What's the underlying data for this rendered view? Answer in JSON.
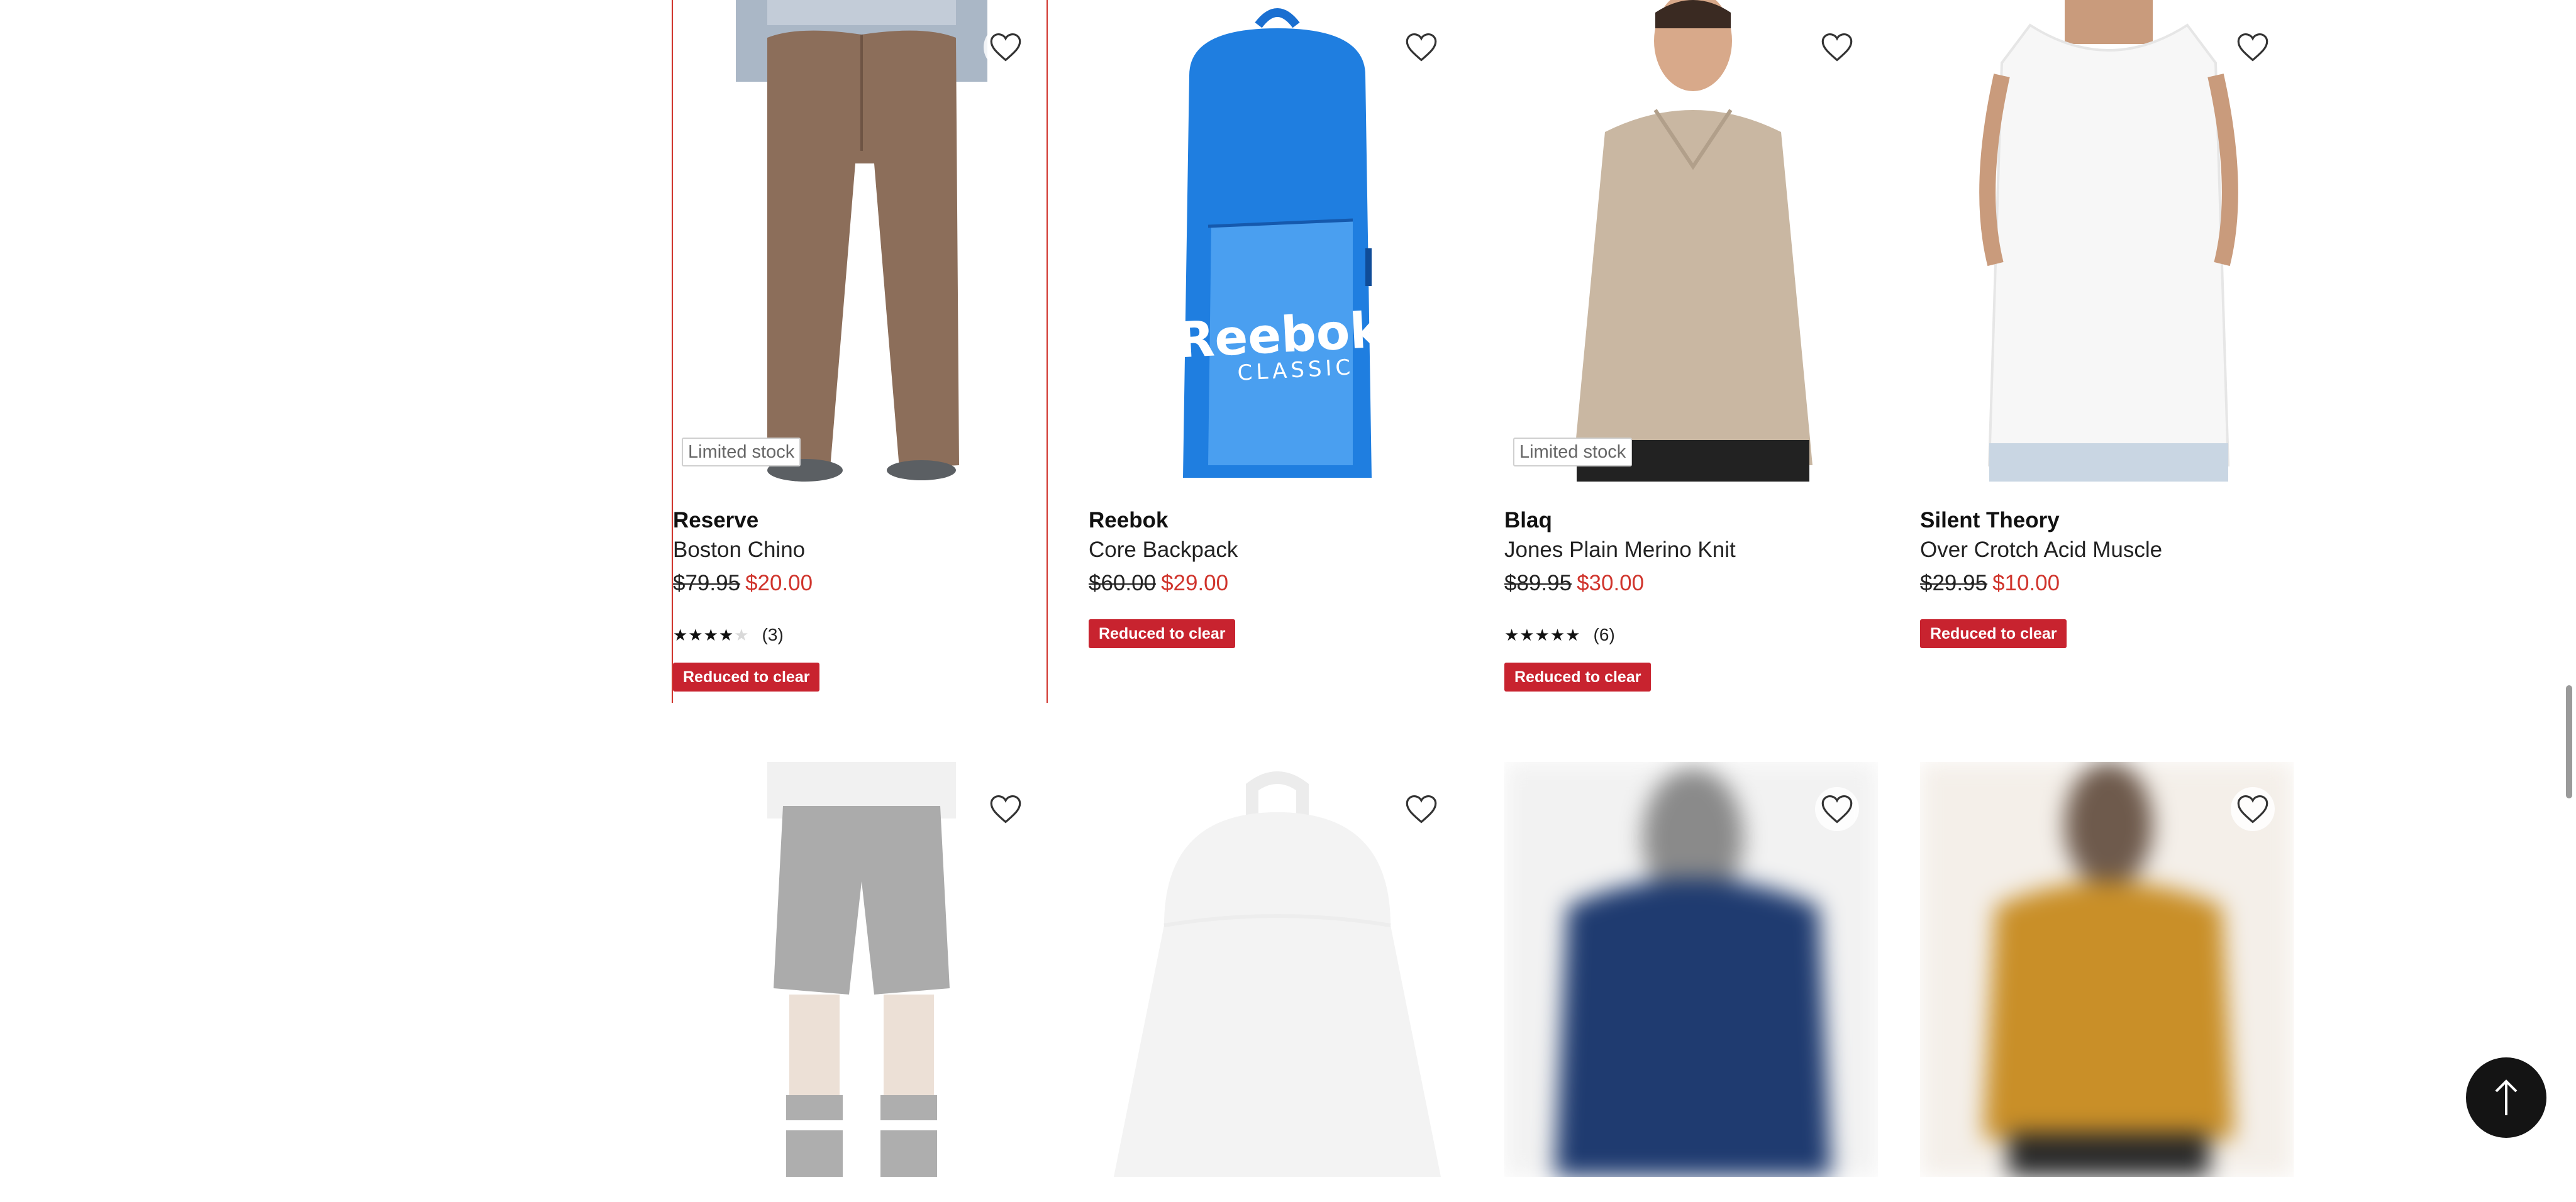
{
  "products": [
    {
      "brand": "Reserve",
      "name": "Boston Chino",
      "was_price": "$79.95",
      "price": "$20.00",
      "stock_badge": "Limited stock",
      "rating_stars": 4.5,
      "review_count": "(3)",
      "promo": "Reduced to clear"
    },
    {
      "brand": "Reebok",
      "name": "Core Backpack",
      "was_price": "$60.00",
      "price": "$29.00",
      "stock_badge": "",
      "promo": "Reduced to clear",
      "logo_text": "Reebok",
      "logo_subtext": "CLASSIC"
    },
    {
      "brand": "Blaq",
      "name": "Jones Plain Merino Knit",
      "was_price": "$89.95",
      "price": "$30.00",
      "stock_badge": "Limited stock",
      "rating_stars": 5,
      "review_count": "(6)",
      "promo": "Reduced to clear"
    },
    {
      "brand": "Silent Theory",
      "name": "Over Crotch Acid Muscle",
      "was_price": "$29.95",
      "price": "$10.00",
      "stock_badge": "",
      "promo": "Reduced to clear"
    }
  ],
  "icons": {
    "wishlist": "heart-outline-icon",
    "back_to_top": "arrow-up-icon"
  },
  "colors": {
    "sale": "#d0342c",
    "promo_badge": "#c8232f",
    "back_to_top_bg": "#141414"
  }
}
